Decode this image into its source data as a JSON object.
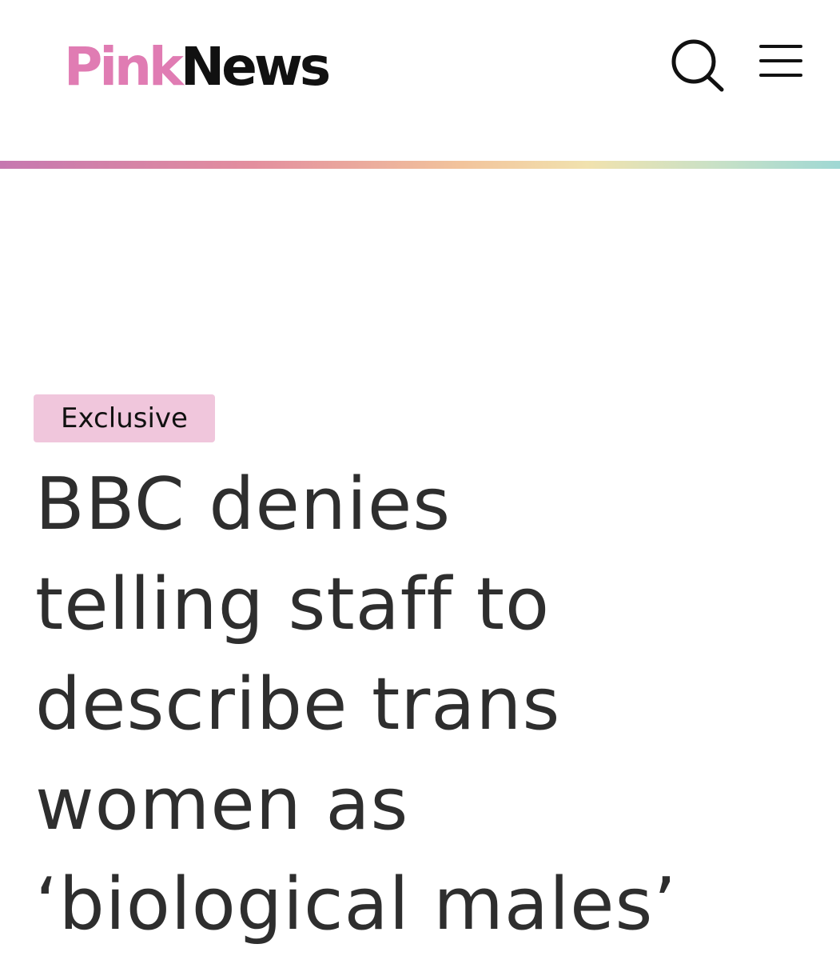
{
  "header": {
    "logo": {
      "pink_part": "Pink",
      "dark_part": "News"
    },
    "search_icon": "search-icon",
    "menu_icon": "hamburger-menu-icon"
  },
  "colors": {
    "brand_pink": "#e07cb3",
    "badge_bg": "#f0c6dc",
    "headline_text": "#2e2e2e",
    "rainbow_bar": [
      "#c678b0",
      "#e38e9e",
      "#f2c49c",
      "#f1e2ae",
      "#c9e1c6",
      "#9fd8d4"
    ]
  },
  "article": {
    "badge": "Exclusive",
    "headline_lines": [
      "BBC denies",
      "telling staff to",
      "describe trans",
      "women as",
      "‘biological males’"
    ]
  }
}
